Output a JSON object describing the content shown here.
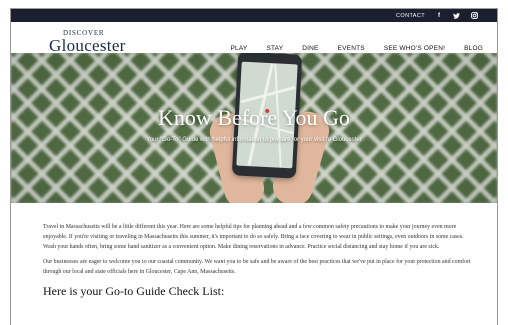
{
  "topbar": {
    "contact_label": "CONTACT",
    "social": [
      {
        "name": "facebook-icon",
        "glyph": "f"
      },
      {
        "name": "twitter-icon",
        "glyph": "t"
      },
      {
        "name": "instagram-icon",
        "glyph": ""
      }
    ]
  },
  "logo": {
    "line1": "DISCOVER",
    "line2": "Gloucester"
  },
  "nav": {
    "items": [
      "PLAY",
      "STAY",
      "DINE",
      "EVENTS",
      "SEE WHO'S OPEN!",
      "BLOG"
    ]
  },
  "hero": {
    "title": "Know Before You Go",
    "subtitle": "Your \"Go-To\" Guide with helpful information to prepare for your visit to Gloucester"
  },
  "content": {
    "paragraph1": "Travel in Massachusetts will be a little different this year. Here are some helpful tips for planning ahead and a few common safety precautions to make your journey even more enjoyable. If you're visiting or traveling in Massachusetts this summer, it's important to do so safely. Bring a face covering to wear in public settings, even outdoors in some cases. Wash your hands often, bring some hand sanitizer as a convenient option. Make dining reservations in advance. Practice social distancing and stay home if you are sick.",
    "paragraph2": "Our businesses are eager to welcome you to our coastal community. We want you to be safe and be aware of the best practices that we've put in place for your protection and comfort through our local and state officials here in Gloucester, Cape Ann, Massachusetts.",
    "heading": "Here is your Go-to Guide Check List:"
  },
  "colors": {
    "topbar_bg": "#1b1f2f",
    "logo": "#1b2a4a",
    "body_text": "#333333"
  }
}
